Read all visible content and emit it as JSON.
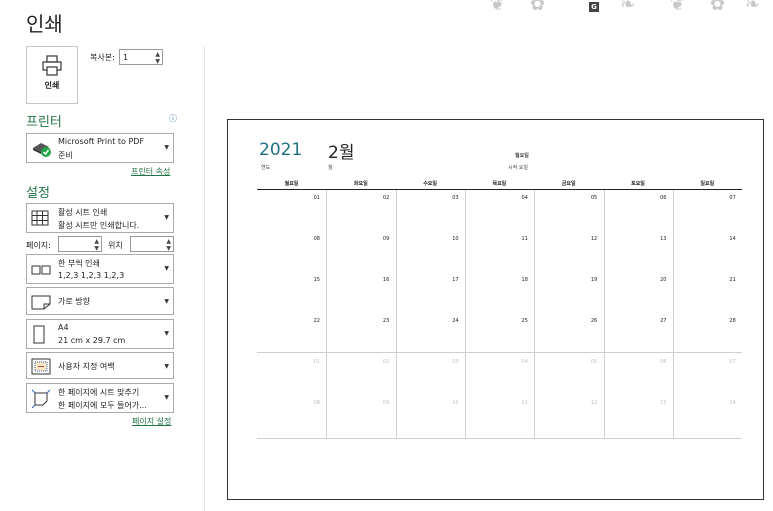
{
  "header": {
    "title": "인쇄",
    "badge": "G"
  },
  "print_button": {
    "label": "인쇄"
  },
  "copies": {
    "label": "복사본:",
    "value": "1"
  },
  "printer": {
    "section_title": "프린터",
    "name": "Microsoft Print to PDF",
    "status": "준비",
    "properties_link": "프린터 속성"
  },
  "settings": {
    "section_title": "설정",
    "scope": {
      "line1": "활성 시트 인쇄",
      "line2": "활성 시트만 인쇄합니다."
    },
    "pages": {
      "label": "페이지:",
      "to_label": "위치"
    },
    "collate": {
      "line1": "한 부씩 인쇄",
      "line2": "1,2,3    1,2,3    1,2,3"
    },
    "orientation": {
      "line1": "가로 방향"
    },
    "paper": {
      "line1": "A4",
      "line2": "21 cm x 29.7 cm"
    },
    "margins": {
      "line1": "사용자 지정 여백"
    },
    "scaling": {
      "line1": "한 페이지에 시트 맞추기",
      "line2": "한 페이지에 모두 들어가..."
    },
    "page_setup_link": "페이지 설정"
  },
  "preview": {
    "year": "2021",
    "year_label": "연도",
    "month": "2월",
    "month_label": "월",
    "start_day": "월요일",
    "start_day_label": "시작 요일",
    "weekdays": [
      "월요일",
      "화요일",
      "수요일",
      "목요일",
      "금요일",
      "토요일",
      "일요일"
    ],
    "weeks": [
      [
        "01",
        "02",
        "03",
        "04",
        "05",
        "06",
        "07"
      ],
      [
        "08",
        "09",
        "10",
        "11",
        "12",
        "13",
        "14"
      ],
      [
        "15",
        "16",
        "17",
        "18",
        "19",
        "20",
        "21"
      ],
      [
        "22",
        "23",
        "24",
        "25",
        "26",
        "27",
        "28"
      ],
      [
        "01",
        "02",
        "03",
        "04",
        "05",
        "06",
        "07"
      ],
      [
        "08",
        "09",
        "10",
        "11",
        "12",
        "13",
        "14"
      ]
    ],
    "dim_weeks": [
      4,
      5
    ]
  },
  "colors": {
    "accent": "#217346",
    "year": "#217384"
  }
}
